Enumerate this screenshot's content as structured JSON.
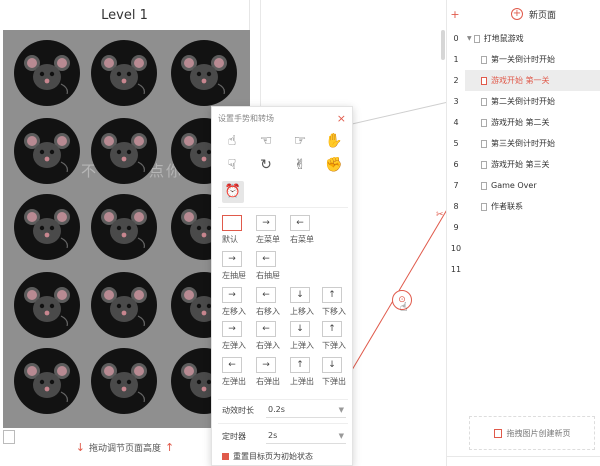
{
  "level_title": "Level 1",
  "canvas_watermark": "不　　　点你",
  "canvas_footer": "拖动调节页面高度",
  "panel": {
    "title": "设置手势和转场",
    "close": "×",
    "gesture_icons": [
      "tap-icon",
      "double-tap-icon",
      "long-press-icon",
      "swipe-left-icon",
      "swipe-right-icon",
      "rotate-icon",
      "pinch-icon",
      "shake-icon",
      "timer-icon"
    ],
    "animations": [
      {
        "label": "默认",
        "glyph": ""
      },
      {
        "label": "左菜单",
        "glyph": "→"
      },
      {
        "label": "右菜单",
        "glyph": "←"
      },
      {
        "label": "左抽屉",
        "glyph": "→"
      },
      {
        "label": "右抽屉",
        "glyph": "←"
      },
      {
        "label": "左移入",
        "glyph": "→"
      },
      {
        "label": "右移入",
        "glyph": "←"
      },
      {
        "label": "上移入",
        "glyph": "↓"
      },
      {
        "label": "下移入",
        "glyph": "↑"
      },
      {
        "label": "左弹入",
        "glyph": "→"
      },
      {
        "label": "右弹入",
        "glyph": "←"
      },
      {
        "label": "上弹入",
        "glyph": "↓"
      },
      {
        "label": "下弹入",
        "glyph": "↑"
      },
      {
        "label": "左弹出",
        "glyph": "←"
      },
      {
        "label": "右弹出",
        "glyph": "→"
      },
      {
        "label": "上弹出",
        "glyph": "↑"
      },
      {
        "label": "下弹出",
        "glyph": "↓"
      }
    ],
    "duration_label": "动效时长",
    "duration_value": "0.2s",
    "timer_label": "定时器",
    "timer_value": "2s",
    "reset_label": "重置目标页为初始状态"
  },
  "pages": {
    "new_page": "新页面",
    "numbers": [
      "0",
      "1",
      "2",
      "3",
      "4",
      "5",
      "6",
      "7",
      "8",
      "9",
      "10",
      "11"
    ],
    "root": "打地鼠游戏",
    "items": [
      {
        "label": "第一关倒计时开始",
        "selected": false
      },
      {
        "label": "游戏开始 第一关",
        "selected": true
      },
      {
        "label": "第二关倒计时开始",
        "selected": false
      },
      {
        "label": "游戏开始 第二关",
        "selected": false
      },
      {
        "label": "第三关倒计时开始",
        "selected": false
      },
      {
        "label": "游戏开始 第三关",
        "selected": false
      },
      {
        "label": "Game Over",
        "selected": false
      },
      {
        "label": "作者联系",
        "selected": false
      }
    ],
    "drop_hint": "拖拽图片创建新页"
  },
  "colors": {
    "accent": "#e05a4b",
    "canvas_bg": "#8f8f8f",
    "hole": "#121212"
  }
}
